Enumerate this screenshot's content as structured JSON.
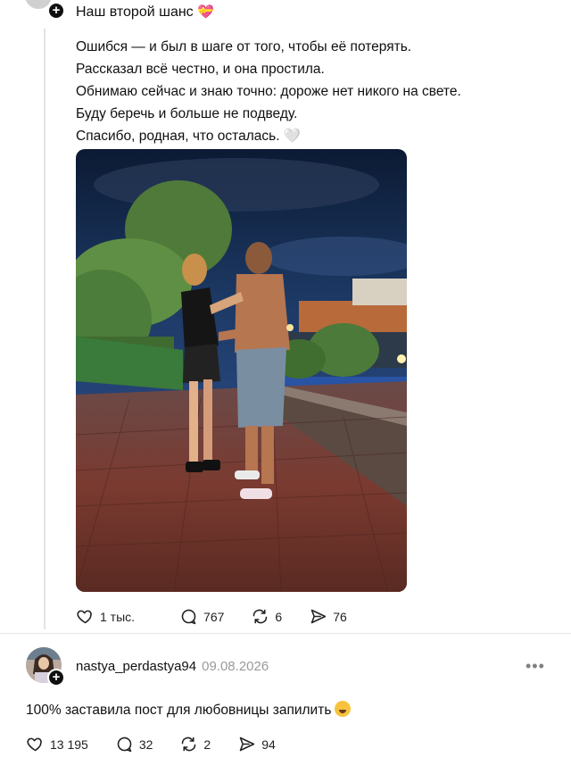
{
  "post": {
    "title": "Наш второй шанс",
    "title_emoji": "💝",
    "body_lines": [
      "Ошибся — и был в шаге от того, чтобы её потерять.",
      "Рассказал всё честно, и она простила.",
      "Обнимаю сейчас и знаю точно: дороже нет никого на свете.",
      "Буду беречь и больше не подведу.",
      "Спасибо, родная, что осталась."
    ],
    "body_end_emoji": "🤍",
    "photo_description_icon": "photo-couple-night-embankment",
    "stats": {
      "likes": "1 тыс.",
      "comments": "767",
      "reposts": "6",
      "shares": "76"
    }
  },
  "reply": {
    "username": "nastya_perdastya94",
    "date": "09.08.2026",
    "text": "100% заставила пост для любовницы запилить",
    "stats": {
      "likes": "13 195",
      "comments": "32",
      "reposts": "2",
      "shares": "94"
    }
  },
  "icons": {
    "like": "heart-icon",
    "comment": "comment-bubble-icon",
    "repost": "repost-icon",
    "share": "share-arrow-icon",
    "more": "more-dots-icon",
    "follow": "plus-icon"
  },
  "colors": {
    "text": "#101010",
    "muted": "#9a9a9a",
    "title_heart": "#e0468a"
  }
}
